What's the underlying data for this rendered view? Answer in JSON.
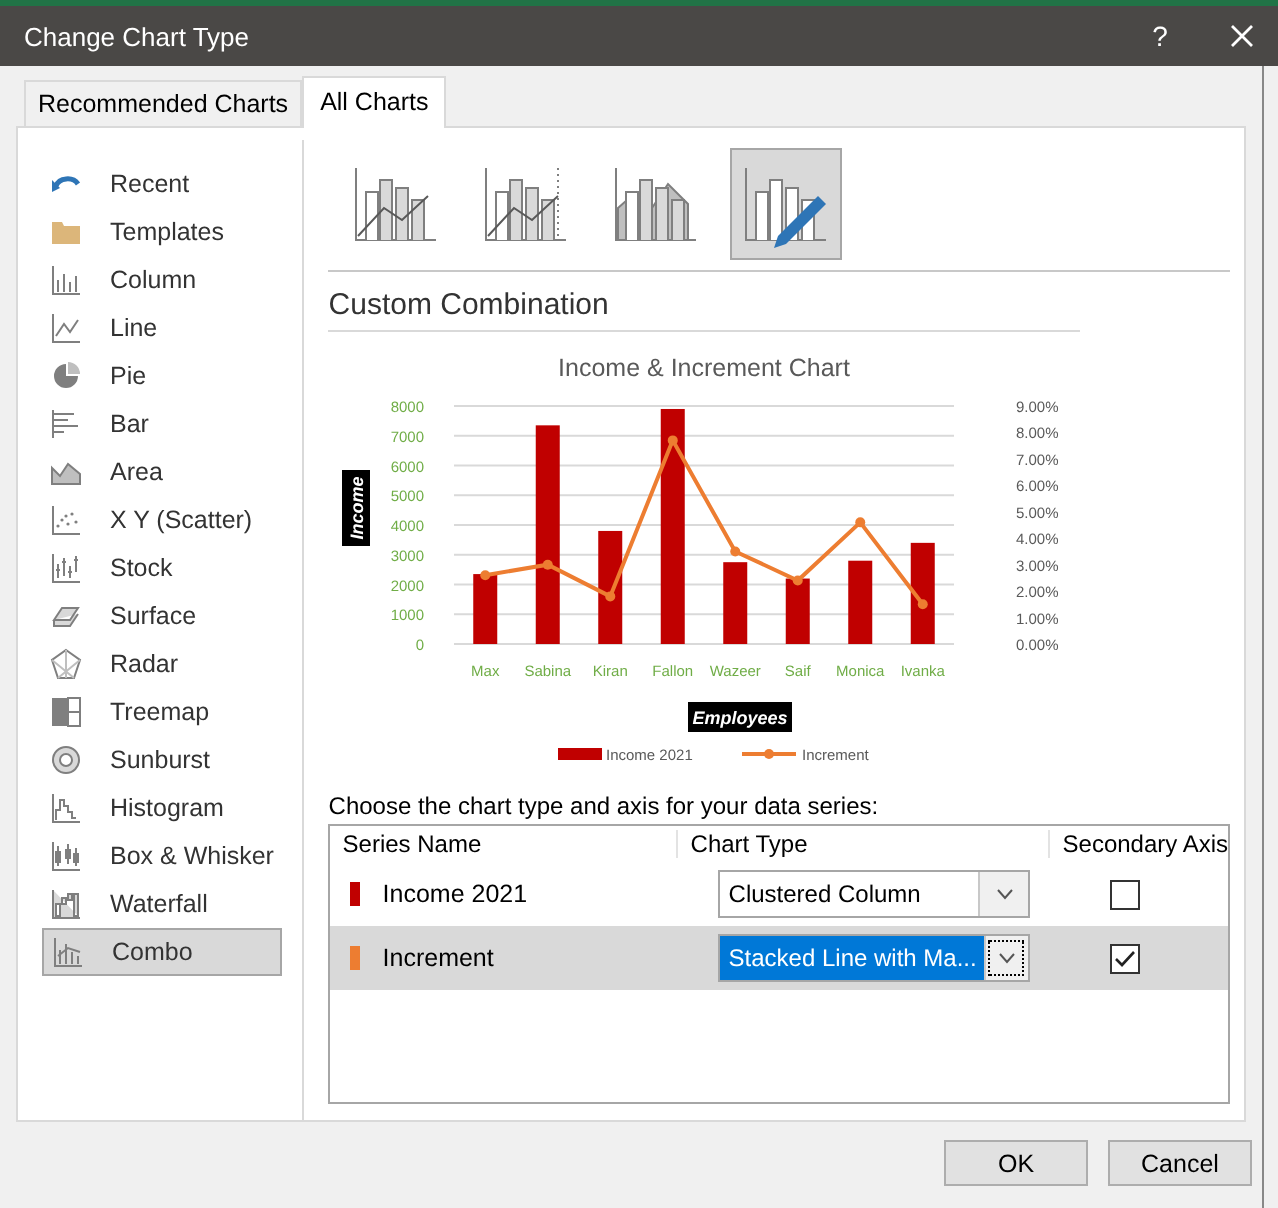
{
  "window": {
    "title": "Change Chart Type",
    "help": "?"
  },
  "tabs": [
    {
      "label": "Recommended Charts",
      "selected": false
    },
    {
      "label": "All Charts",
      "selected": true
    }
  ],
  "sidebar": {
    "items": [
      {
        "label": "Recent",
        "selected": false
      },
      {
        "label": "Templates",
        "selected": false
      },
      {
        "label": "Column",
        "selected": false
      },
      {
        "label": "Line",
        "selected": false
      },
      {
        "label": "Pie",
        "selected": false
      },
      {
        "label": "Bar",
        "selected": false
      },
      {
        "label": "Area",
        "selected": false
      },
      {
        "label": "X Y (Scatter)",
        "selected": false
      },
      {
        "label": "Stock",
        "selected": false
      },
      {
        "label": "Surface",
        "selected": false
      },
      {
        "label": "Radar",
        "selected": false
      },
      {
        "label": "Treemap",
        "selected": false
      },
      {
        "label": "Sunburst",
        "selected": false
      },
      {
        "label": "Histogram",
        "selected": false
      },
      {
        "label": "Box & Whisker",
        "selected": false
      },
      {
        "label": "Waterfall",
        "selected": false
      },
      {
        "label": "Combo",
        "selected": true
      }
    ]
  },
  "chart_subtypes": [
    {
      "selected": false
    },
    {
      "selected": false
    },
    {
      "selected": false
    },
    {
      "selected": true
    }
  ],
  "section_title": "Custom Combination",
  "chart": {
    "chart_data": {
      "type": "bar",
      "title": "Income & Increment Chart",
      "xlabel": "Employees",
      "ylabel": "Income",
      "categories": [
        "Max",
        "Sabina",
        "Kiran",
        "Fallon",
        "Wazeer",
        "Saif",
        "Monica",
        "Ivanka"
      ],
      "series": [
        {
          "name": "Income 2021",
          "color": "#c00000",
          "type": "bar",
          "values": [
            2350,
            7350,
            3800,
            7900,
            2750,
            2200,
            2800,
            3400
          ]
        },
        {
          "name": "Increment",
          "color": "#ed7d31",
          "type": "line",
          "axis": "y2",
          "marker": "circle",
          "values": [
            0.026,
            0.03,
            0.018,
            0.077,
            0.035,
            0.024,
            0.046,
            0.015
          ]
        }
      ],
      "grid": "y",
      "legend": "bottom",
      "ylim": [
        0,
        8000
      ],
      "yticks": [
        0,
        1000,
        2000,
        3000,
        4000,
        5000,
        6000,
        7000,
        8000
      ],
      "y2lim": [
        0,
        0.09
      ],
      "y2ticks": [
        {
          "value": 0,
          "label": "0.00%"
        },
        {
          "value": 0.01,
          "label": "1.00%"
        },
        {
          "value": 0.02,
          "label": "2.00%"
        },
        {
          "value": 0.03,
          "label": "3.00%"
        },
        {
          "value": 0.04,
          "label": "4.00%"
        },
        {
          "value": 0.05,
          "label": "5.00%"
        },
        {
          "value": 0.06,
          "label": "6.00%"
        },
        {
          "value": 0.07,
          "label": "7.00%"
        },
        {
          "value": 0.08,
          "label": "8.00%"
        },
        {
          "value": 0.09,
          "label": "9.00%"
        }
      ]
    }
  },
  "series_prompt": "Choose the chart type and axis for your data series:",
  "series_table": {
    "columns": [
      "Series Name",
      "Chart Type",
      "Secondary Axis"
    ],
    "rows": [
      {
        "name": "Income 2021",
        "color": "#c00000",
        "chart_type": "Clustered Column",
        "secondary_axis": false,
        "selected": false
      },
      {
        "name": "Increment",
        "color": "#ed7d31",
        "chart_type": "Stacked Line with Ma...",
        "secondary_axis": true,
        "selected": true
      }
    ]
  },
  "buttons": [
    "OK",
    "Cancel"
  ]
}
